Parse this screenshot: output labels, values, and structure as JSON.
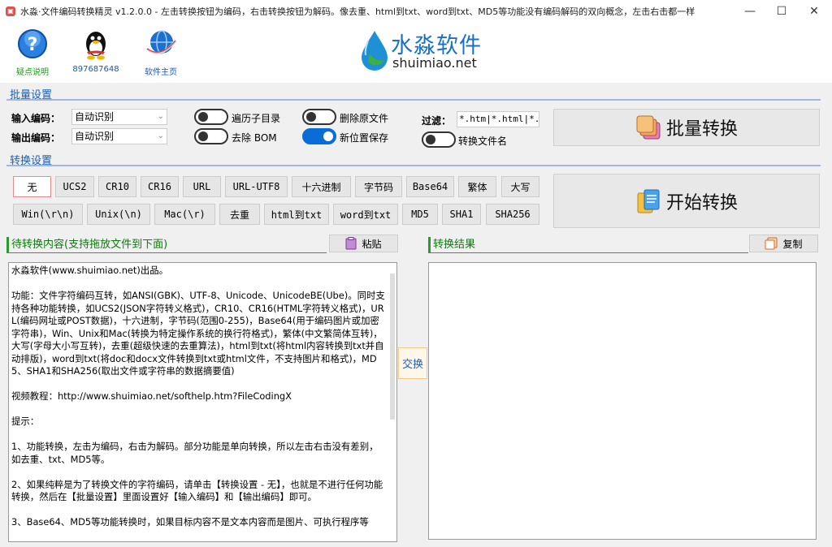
{
  "window": {
    "title": "水淼·文件编码转换精灵 v1.2.0.0 - 左击转换按钮为编码，右击转换按钮为解码。像去重、html到txt、word到txt、MD5等功能没有编码解码的双向概念，左击右击都一样",
    "app_icon": "app-icon"
  },
  "toolbar": {
    "help_label": "疑点说明",
    "qq_label": "897687648",
    "home_label": "软件主页"
  },
  "logo": {
    "cn": "水淼软件",
    "en": "shuimiao.net"
  },
  "batch": {
    "section_title": "批量设置",
    "input_label": "输入编码：",
    "input_value": "自动识别",
    "output_label": "输出编码：",
    "output_value": "自动识别",
    "traverse_label": "遍历子目录",
    "traverse_on": false,
    "delete_label": "删除原文件",
    "delete_on": false,
    "bom_label": "去除 BOM",
    "bom_on": false,
    "newpos_label": "新位置保存",
    "newpos_on": true,
    "filter_label": "过滤：",
    "filter_value": "*.htm|*.html|*.",
    "convname_label": "转换文件名",
    "convname_on": false,
    "batch_button": "批量转换"
  },
  "convert": {
    "section_title": "转换设置",
    "row1": [
      "无",
      "UCS2",
      "CR10",
      "CR16",
      "URL",
      "URL-UTF8",
      "十六进制",
      "字节码",
      "Base64",
      "繁体",
      "大写"
    ],
    "row2": [
      "Win(\\r\\n)",
      "Unix(\\n)",
      "Mac(\\r)",
      "去重",
      "html到txt",
      "word到txt",
      "MD5",
      "SHA1",
      "SHA256"
    ],
    "selected": "无",
    "start_button": "开始转换"
  },
  "left_panel": {
    "title": "待转换内容(支持拖放文件到下面)",
    "paste_button": "粘贴",
    "content": "水淼软件(www.shuimiao.net)出品。\n\n功能：文件字符编码互转，如ANSI(GBK)、UTF-8、Unicode、UnicodeBE(Ube)。同时支持各种功能转换，如UCS2(JSON字符转义格式)，CR10、CR16(HTML字符转义格式)，URL(编码网址或POST数据)，十六进制，字节码(范围0-255)，Base64(用于编码图片或加密字符串)，Win、Unix和Mac(转换为特定操作系统的换行符格式)，繁体(中文繁简体互转)，大写(字母大小写互转)，去重(超级快速的去重算法)，html到txt(将html内容转换到txt并自动排版)，word到txt(将doc和docx文件转换到txt或html文件，不支持图片和格式)，MD5、SHA1和SHA256(取出文件或字符串的数据摘要值)\n\n视频教程：http://www.shuimiao.net/softhelp.htm?FileCodingX\n\n提示：\n\n1、功能转换，左击为编码，右击为解码。部分功能是单向转换，所以左击右击没有差别，如去重、txt、MD5等。\n\n2、如果纯粹是为了转换文件的字符编码，请单击【转换设置 - 无】，也就是不进行任何功能转换，然后在【批量设置】里面设置好【输入编码】和【输出编码】即可。\n\n3、Base64、MD5等功能转换时，如果目标内容不是文本内容而是图片、可执行程序等"
  },
  "swap_button": "交换",
  "right_panel": {
    "title": "转换结果",
    "copy_button": "复制",
    "content": ""
  },
  "colors": {
    "accent": "#1a5fb4",
    "green": "#2a9a2a",
    "toggle_on": "#0a6cd6"
  }
}
